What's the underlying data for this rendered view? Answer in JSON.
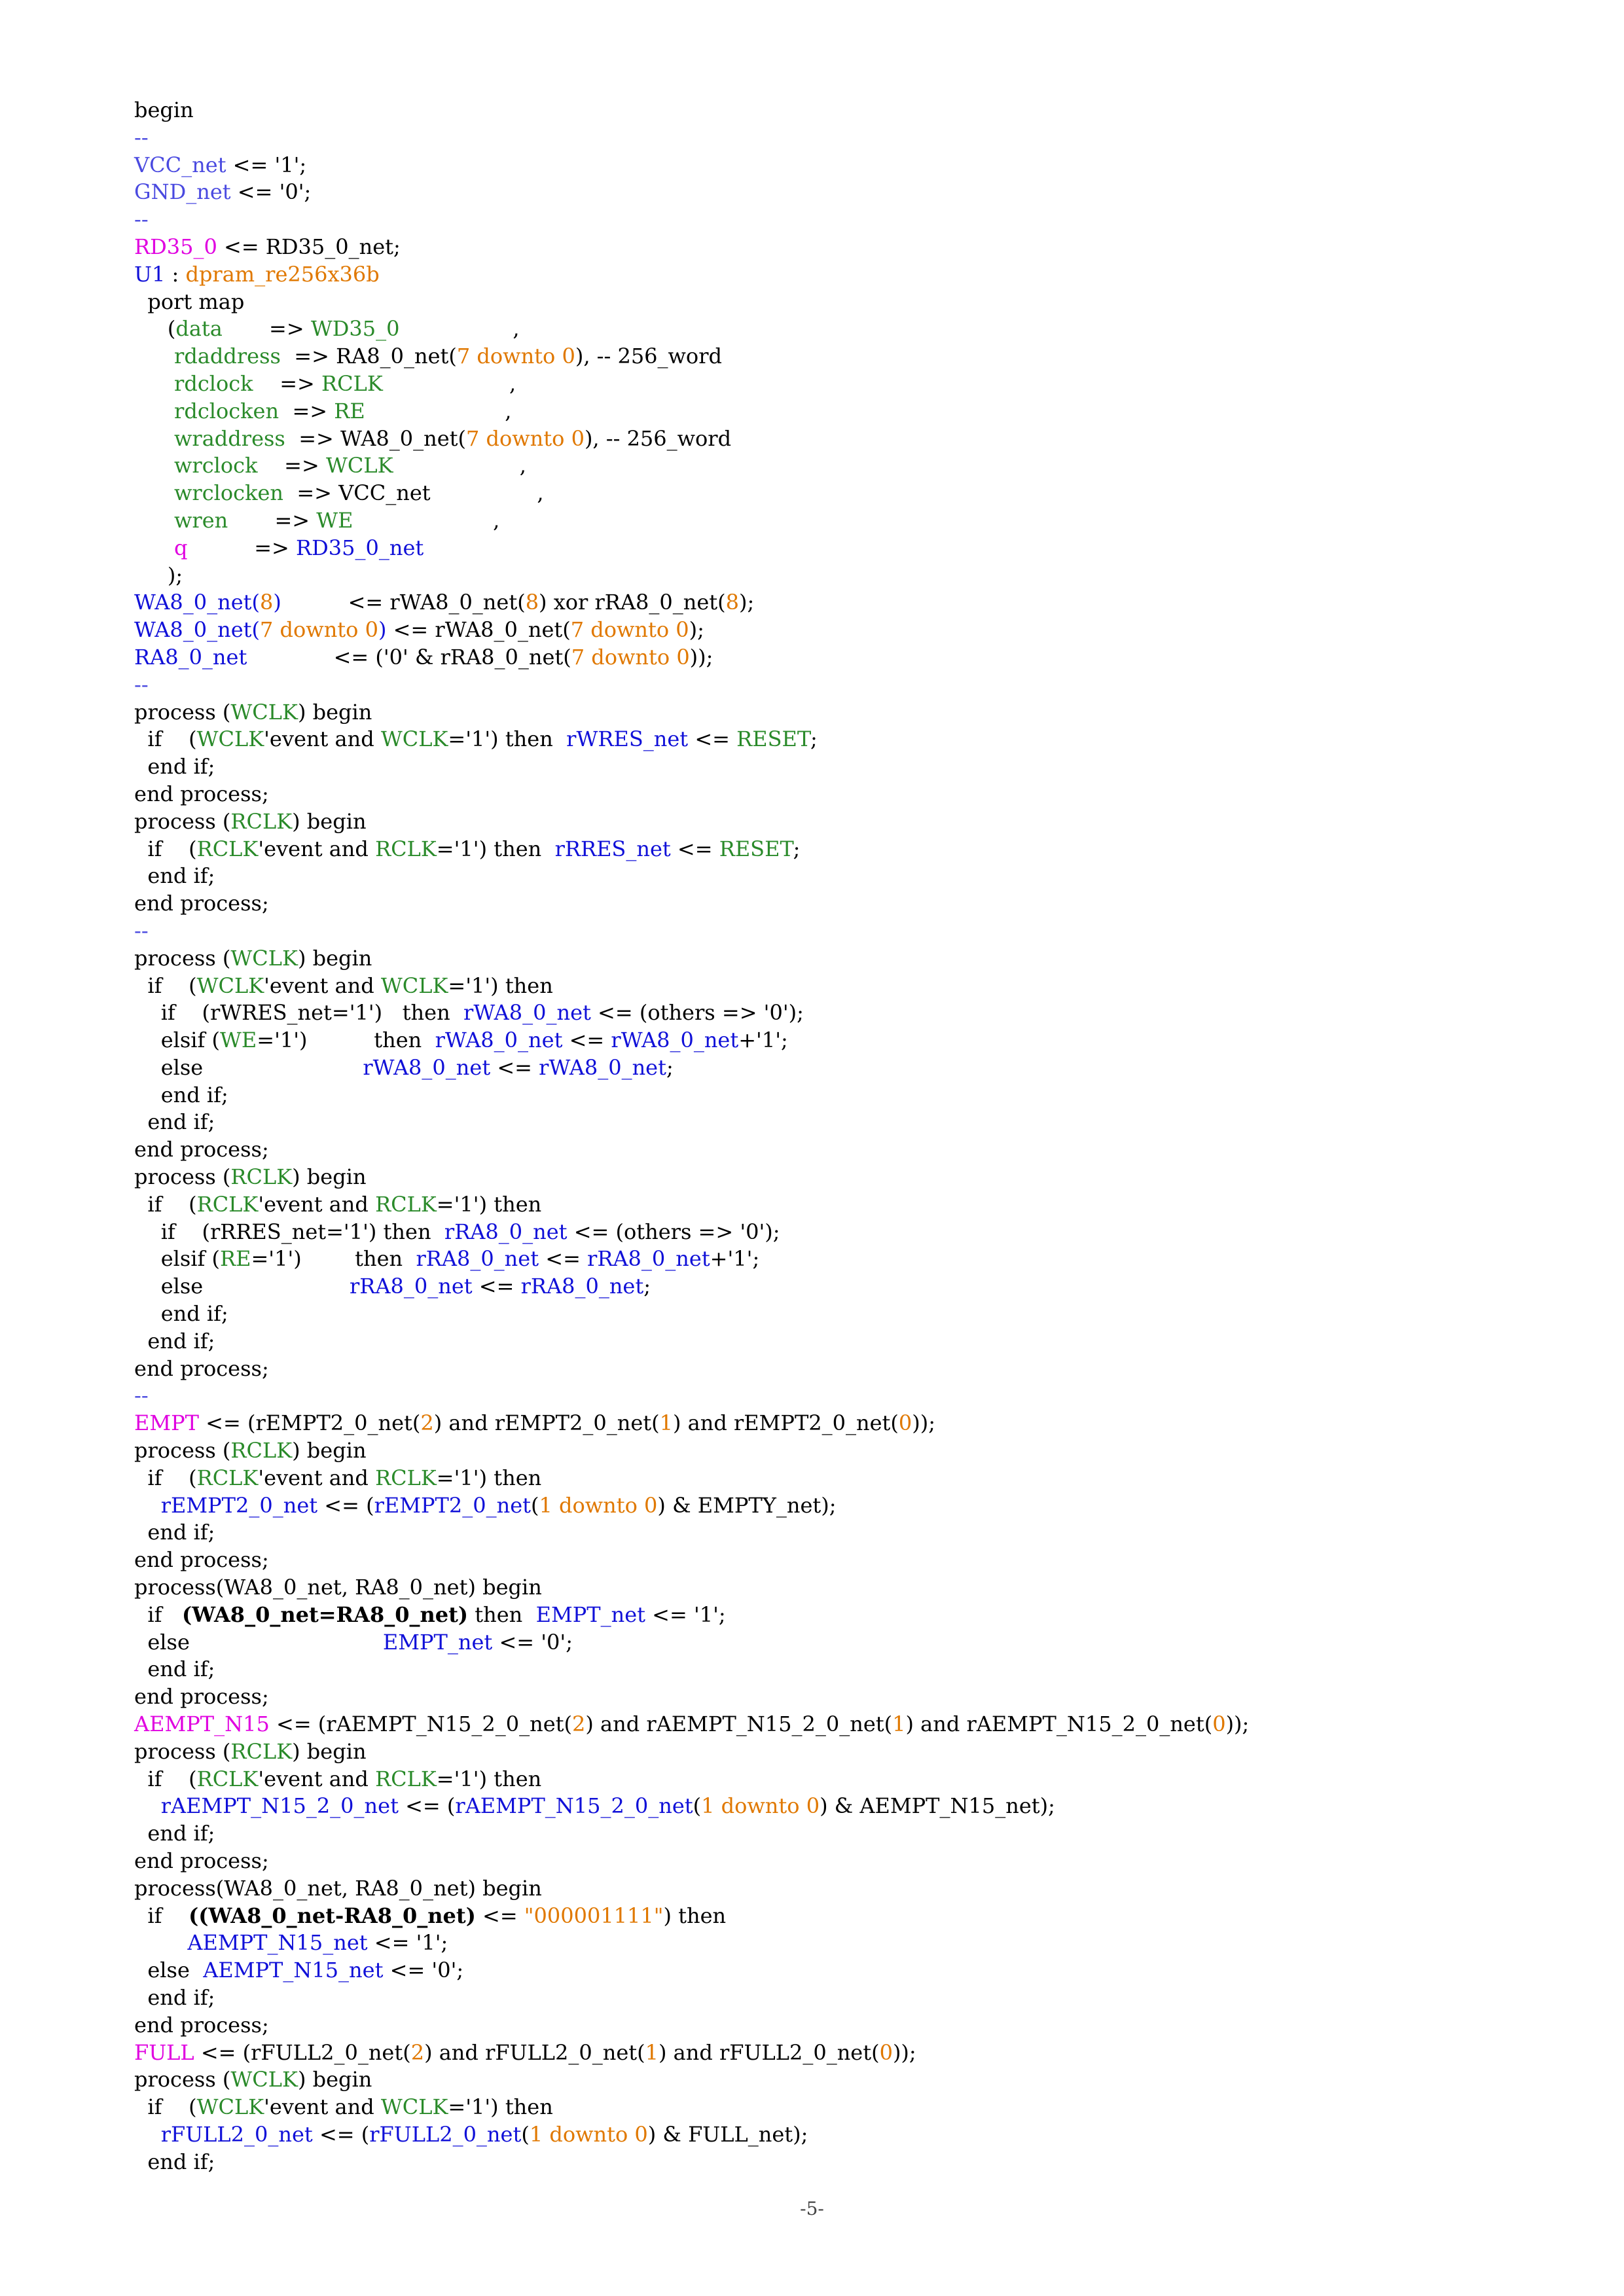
{
  "colors": {
    "k": "#000000",
    "m": "#e000e0",
    "o": "#e07800",
    "g": "#2a8a2a",
    "b": "#1010d8",
    "c": "#4a4ae0",
    "s": "#e07800"
  },
  "page_number": "-5-",
  "lines": [
    [
      [
        "k",
        "begin"
      ]
    ],
    [
      [
        "c",
        "--"
      ]
    ],
    [
      [
        "c",
        "VCC_net"
      ],
      [
        "k",
        " <= '1';"
      ]
    ],
    [
      [
        "c",
        "GND_net"
      ],
      [
        "k",
        " <= '0';"
      ]
    ],
    [
      [
        "c",
        "--"
      ]
    ],
    [
      [
        "m",
        "RD35_0"
      ],
      [
        "k",
        " <= RD35_0_net;"
      ]
    ],
    [
      [
        "b",
        "U1"
      ],
      [
        "k",
        " : "
      ],
      [
        "o",
        "dpram_re256x36b"
      ]
    ],
    [
      [
        "k",
        "  port map"
      ]
    ],
    [
      [
        "k",
        "     ("
      ],
      [
        "g",
        "data"
      ],
      [
        "k",
        "       => "
      ],
      [
        "g",
        "WD35_0"
      ],
      [
        "k",
        "                 ,"
      ]
    ],
    [
      [
        "g",
        "      rdaddress"
      ],
      [
        "k",
        "  => RA8_0_net("
      ],
      [
        "o",
        "7"
      ],
      [
        "k",
        " "
      ],
      [
        "o",
        "downto"
      ],
      [
        "k",
        " "
      ],
      [
        "o",
        "0"
      ],
      [
        "k",
        "), -- 256_word"
      ]
    ],
    [
      [
        "g",
        "      rdclock"
      ],
      [
        "k",
        "    => "
      ],
      [
        "g",
        "RCLK"
      ],
      [
        "k",
        "                   ,"
      ]
    ],
    [
      [
        "g",
        "      rdclocken"
      ],
      [
        "k",
        "  => "
      ],
      [
        "g",
        "RE"
      ],
      [
        "k",
        "                     ,"
      ]
    ],
    [
      [
        "g",
        "      wraddress"
      ],
      [
        "k",
        "  => WA8_0_net("
      ],
      [
        "o",
        "7"
      ],
      [
        "k",
        " "
      ],
      [
        "o",
        "downto"
      ],
      [
        "k",
        " "
      ],
      [
        "o",
        "0"
      ],
      [
        "k",
        "), -- 256_word"
      ]
    ],
    [
      [
        "g",
        "      wrclock"
      ],
      [
        "k",
        "    => "
      ],
      [
        "g",
        "WCLK"
      ],
      [
        "k",
        "                   ,"
      ]
    ],
    [
      [
        "g",
        "      wrclocken"
      ],
      [
        "k",
        "  => VCC_net                ,"
      ]
    ],
    [
      [
        "g",
        "      wren"
      ],
      [
        "k",
        "       => "
      ],
      [
        "g",
        "WE"
      ],
      [
        "k",
        "                     ,"
      ]
    ],
    [
      [
        "m",
        "      q"
      ],
      [
        "k",
        "          => "
      ],
      [
        "b",
        "RD35_0_net"
      ]
    ],
    [
      [
        "k",
        "     );"
      ]
    ],
    [
      [
        "b",
        "WA8_0_net("
      ],
      [
        "o",
        "8"
      ],
      [
        "b",
        ")"
      ],
      [
        "k",
        "          <= rWA8_0_net("
      ],
      [
        "o",
        "8"
      ],
      [
        "k",
        ") xor rRA8_0_net("
      ],
      [
        "o",
        "8"
      ],
      [
        "k",
        ");"
      ]
    ],
    [
      [
        "b",
        "WA8_0_net("
      ],
      [
        "o",
        "7"
      ],
      [
        "b",
        " "
      ],
      [
        "o",
        "downto"
      ],
      [
        "b",
        " "
      ],
      [
        "o",
        "0"
      ],
      [
        "b",
        ")"
      ],
      [
        "k",
        " <= rWA8_0_net("
      ],
      [
        "o",
        "7"
      ],
      [
        "k",
        " "
      ],
      [
        "o",
        "downto"
      ],
      [
        "k",
        " "
      ],
      [
        "o",
        "0"
      ],
      [
        "k",
        ");"
      ]
    ],
    [
      [
        "b",
        "RA8_0_net"
      ],
      [
        "k",
        "             <= ('0' & rRA8_0_net("
      ],
      [
        "o",
        "7"
      ],
      [
        "k",
        " "
      ],
      [
        "o",
        "downto"
      ],
      [
        "k",
        " "
      ],
      [
        "o",
        "0"
      ],
      [
        "k",
        "));"
      ]
    ],
    [
      [
        "c",
        "--"
      ]
    ],
    [
      [
        "k",
        "process ("
      ],
      [
        "g",
        "WCLK"
      ],
      [
        "k",
        ") begin"
      ]
    ],
    [
      [
        "k",
        "  if    ("
      ],
      [
        "g",
        "WCLK"
      ],
      [
        "k",
        "'event and "
      ],
      [
        "g",
        "WCLK"
      ],
      [
        "k",
        "='1') then  "
      ],
      [
        "b",
        "rWRES_net"
      ],
      [
        "k",
        " <= "
      ],
      [
        "g",
        "RESET"
      ],
      [
        "k",
        ";"
      ]
    ],
    [
      [
        "k",
        "  end if;"
      ]
    ],
    [
      [
        "k",
        "end process;"
      ]
    ],
    [
      [
        "k",
        "process ("
      ],
      [
        "g",
        "RCLK"
      ],
      [
        "k",
        ") begin"
      ]
    ],
    [
      [
        "k",
        "  if    ("
      ],
      [
        "g",
        "RCLK"
      ],
      [
        "k",
        "'event and "
      ],
      [
        "g",
        "RCLK"
      ],
      [
        "k",
        "='1') then  "
      ],
      [
        "b",
        "rRRES_net"
      ],
      [
        "k",
        " <= "
      ],
      [
        "g",
        "RESET"
      ],
      [
        "k",
        ";"
      ]
    ],
    [
      [
        "k",
        "  end if;"
      ]
    ],
    [
      [
        "k",
        "end process;"
      ]
    ],
    [
      [
        "c",
        "--"
      ]
    ],
    [
      [
        "k",
        "process ("
      ],
      [
        "g",
        "WCLK"
      ],
      [
        "k",
        ") begin"
      ]
    ],
    [
      [
        "k",
        "  if    ("
      ],
      [
        "g",
        "WCLK"
      ],
      [
        "k",
        "'event and "
      ],
      [
        "g",
        "WCLK"
      ],
      [
        "k",
        "='1') then"
      ]
    ],
    [
      [
        "k",
        "    if    (rWRES_net='1')   then  "
      ],
      [
        "b",
        "rWA8_0_net"
      ],
      [
        "k",
        " <= (others => '0');"
      ]
    ],
    [
      [
        "k",
        "    elsif ("
      ],
      [
        "g",
        "WE"
      ],
      [
        "k",
        "='1')          then  "
      ],
      [
        "b",
        "rWA8_0_net"
      ],
      [
        "k",
        " <= "
      ],
      [
        "b",
        "rWA8_0_net"
      ],
      [
        "k",
        "+'1';"
      ]
    ],
    [
      [
        "k",
        "    else                        "
      ],
      [
        "b",
        "rWA8_0_net"
      ],
      [
        "k",
        " <= "
      ],
      [
        "b",
        "rWA8_0_net"
      ],
      [
        "k",
        ";"
      ]
    ],
    [
      [
        "k",
        "    end if;"
      ]
    ],
    [
      [
        "k",
        "  end if;"
      ]
    ],
    [
      [
        "k",
        "end process;"
      ]
    ],
    [
      [
        "k",
        "process ("
      ],
      [
        "g",
        "RCLK"
      ],
      [
        "k",
        ") begin"
      ]
    ],
    [
      [
        "k",
        "  if    ("
      ],
      [
        "g",
        "RCLK"
      ],
      [
        "k",
        "'event and "
      ],
      [
        "g",
        "RCLK"
      ],
      [
        "k",
        "='1') then"
      ]
    ],
    [
      [
        "k",
        "    if    (rRRES_net='1') then  "
      ],
      [
        "b",
        "rRA8_0_net"
      ],
      [
        "k",
        " <= (others => '0');"
      ]
    ],
    [
      [
        "k",
        "    elsif ("
      ],
      [
        "g",
        "RE"
      ],
      [
        "k",
        "='1')        then  "
      ],
      [
        "b",
        "rRA8_0_net"
      ],
      [
        "k",
        " <= "
      ],
      [
        "b",
        "rRA8_0_net"
      ],
      [
        "k",
        "+'1';"
      ]
    ],
    [
      [
        "k",
        "    else                      "
      ],
      [
        "b",
        "rRA8_0_net"
      ],
      [
        "k",
        " <= "
      ],
      [
        "b",
        "rRA8_0_net"
      ],
      [
        "k",
        ";"
      ]
    ],
    [
      [
        "k",
        "    end if;"
      ]
    ],
    [
      [
        "k",
        "  end if;"
      ]
    ],
    [
      [
        "k",
        "end process;"
      ]
    ],
    [
      [
        "c",
        "--"
      ]
    ],
    [
      [
        "m",
        "EMPT"
      ],
      [
        "k",
        " <= (rEMPT2_0_net("
      ],
      [
        "o",
        "2"
      ],
      [
        "k",
        ") and rEMPT2_0_net("
      ],
      [
        "o",
        "1"
      ],
      [
        "k",
        ") and rEMPT2_0_net("
      ],
      [
        "o",
        "0"
      ],
      [
        "k",
        "));"
      ]
    ],
    [
      [
        "k",
        "process ("
      ],
      [
        "g",
        "RCLK"
      ],
      [
        "k",
        ") begin"
      ]
    ],
    [
      [
        "k",
        "  if    ("
      ],
      [
        "g",
        "RCLK"
      ],
      [
        "k",
        "'event and "
      ],
      [
        "g",
        "RCLK"
      ],
      [
        "k",
        "='1') then"
      ]
    ],
    [
      [
        "b",
        "    rEMPT2_0_net"
      ],
      [
        "k",
        " <= ("
      ],
      [
        "b",
        "rEMPT2_0_net"
      ],
      [
        "k",
        "("
      ],
      [
        "o",
        "1"
      ],
      [
        "k",
        " "
      ],
      [
        "o",
        "downto"
      ],
      [
        "k",
        " "
      ],
      [
        "o",
        "0"
      ],
      [
        "k",
        ") & EMPTY_net);"
      ]
    ],
    [
      [
        "k",
        "  end if;"
      ]
    ],
    [
      [
        "k",
        "end process;"
      ]
    ],
    [
      [
        "k",
        "process(WA8_0_net, RA8_0_net) begin"
      ]
    ],
    [
      [
        "k",
        "  if   "
      ],
      [
        "k_b",
        "(WA8_0_net=RA8_0_net)"
      ],
      [
        "k",
        " then  "
      ],
      [
        "b",
        "EMPT_net"
      ],
      [
        "k",
        " <= '1';"
      ]
    ],
    [
      [
        "k",
        "  else                             "
      ],
      [
        "b",
        "EMPT_net"
      ],
      [
        "k",
        " <= '0';"
      ]
    ],
    [
      [
        "k",
        "  end if;"
      ]
    ],
    [
      [
        "k",
        "end process;"
      ]
    ],
    [
      [
        "m",
        "AEMPT_N15"
      ],
      [
        "k",
        " <= (rAEMPT_N15_2_0_net("
      ],
      [
        "o",
        "2"
      ],
      [
        "k",
        ") and rAEMPT_N15_2_0_net("
      ],
      [
        "o",
        "1"
      ],
      [
        "k",
        ") and rAEMPT_N15_2_0_net("
      ],
      [
        "o",
        "0"
      ],
      [
        "k",
        "));"
      ]
    ],
    [
      [
        "k",
        "process ("
      ],
      [
        "g",
        "RCLK"
      ],
      [
        "k",
        ") begin"
      ]
    ],
    [
      [
        "k",
        "  if    ("
      ],
      [
        "g",
        "RCLK"
      ],
      [
        "k",
        "'event and "
      ],
      [
        "g",
        "RCLK"
      ],
      [
        "k",
        "='1') then"
      ]
    ],
    [
      [
        "b",
        "    rAEMPT_N15_2_0_net"
      ],
      [
        "k",
        " <= ("
      ],
      [
        "b",
        "rAEMPT_N15_2_0_net"
      ],
      [
        "k",
        "("
      ],
      [
        "o",
        "1"
      ],
      [
        "k",
        " "
      ],
      [
        "o",
        "downto"
      ],
      [
        "k",
        " "
      ],
      [
        "o",
        "0"
      ],
      [
        "k",
        ") & AEMPT_N15_net);"
      ]
    ],
    [
      [
        "k",
        "  end if;"
      ]
    ],
    [
      [
        "k",
        "end process;"
      ]
    ],
    [
      [
        "k",
        "process(WA8_0_net, RA8_0_net) begin"
      ]
    ],
    [
      [
        "k",
        "  if    "
      ],
      [
        "k_b",
        "((WA8_0_net-RA8_0_net)"
      ],
      [
        "k",
        " <= "
      ],
      [
        "s",
        "\"000001111\""
      ],
      [
        "k",
        ") then"
      ]
    ],
    [
      [
        "b",
        "        AEMPT_N15_net"
      ],
      [
        "k",
        " <= '1';"
      ]
    ],
    [
      [
        "k",
        "  else  "
      ],
      [
        "b",
        "AEMPT_N15_net"
      ],
      [
        "k",
        " <= '0';"
      ]
    ],
    [
      [
        "k",
        "  end if;"
      ]
    ],
    [
      [
        "k",
        "end process;"
      ]
    ],
    [
      [
        "m",
        "FULL"
      ],
      [
        "k",
        " <= (rFULL2_0_net("
      ],
      [
        "o",
        "2"
      ],
      [
        "k",
        ") and rFULL2_0_net("
      ],
      [
        "o",
        "1"
      ],
      [
        "k",
        ") and rFULL2_0_net("
      ],
      [
        "o",
        "0"
      ],
      [
        "k",
        "));"
      ]
    ],
    [
      [
        "k",
        "process ("
      ],
      [
        "g",
        "WCLK"
      ],
      [
        "k",
        ") begin"
      ]
    ],
    [
      [
        "k",
        "  if    ("
      ],
      [
        "g",
        "WCLK"
      ],
      [
        "k",
        "'event and "
      ],
      [
        "g",
        "WCLK"
      ],
      [
        "k",
        "='1') then"
      ]
    ],
    [
      [
        "b",
        "    rFULL2_0_net"
      ],
      [
        "k",
        " <= ("
      ],
      [
        "b",
        "rFULL2_0_net"
      ],
      [
        "k",
        "("
      ],
      [
        "o",
        "1"
      ],
      [
        "k",
        " "
      ],
      [
        "o",
        "downto"
      ],
      [
        "k",
        " "
      ],
      [
        "o",
        "0"
      ],
      [
        "k",
        ") & FULL_net);"
      ]
    ],
    [
      [
        "k",
        "  end if;"
      ]
    ]
  ]
}
